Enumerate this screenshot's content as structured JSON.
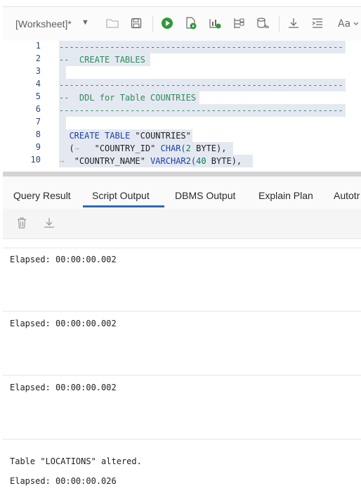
{
  "toolbar": {
    "worksheet_label": "[Worksheet]*",
    "icons": [
      "open-folder-icon",
      "save-icon",
      "run-statement-icon",
      "run-script-icon",
      "autotrace-icon",
      "explain-plan-icon",
      "sql-tuning-icon",
      "download-icon",
      "format-icon",
      "font-icon"
    ]
  },
  "editor": {
    "line_numbers": [
      "1",
      "2",
      "3",
      "4",
      "5",
      "6",
      "7",
      "8",
      "9",
      "10"
    ]
  },
  "tabs": {
    "query_result": "Query Result",
    "script_output": "Script Output",
    "dbms_output": "DBMS Output",
    "explain_plan": "Explain Plan",
    "autotrace": "Autotr"
  },
  "output": {
    "elapsed_1": "Elapsed: 00:00:00.002",
    "elapsed_2": "Elapsed: 00:00:00.002",
    "elapsed_3": "Elapsed: 00:00:00.002",
    "table_altered": "Table \"LOCATIONS\" altered.",
    "elapsed_4": "Elapsed: 00:00:00.026"
  },
  "code": {
    "dashes": "--------------------------------------------------------",
    "dashes_short": "--",
    "line2_text": "CREATE TABLES",
    "line5_text": "DDL for Table COUNTRIES",
    "line8_create": "CREATE",
    "line8_table": "TABLE",
    "line8_name": "\"COUNTRIES\"",
    "line9_open": "(",
    "line9_col": "\"COUNTRY_ID\"",
    "line9_type": "CHAR(",
    "line9_num": "2",
    "line9_byte": "BYTE),",
    "line10_col": "\"COUNTRY_NAME\"",
    "line10_type": "VARCHAR2(",
    "line10_num": "40",
    "line10_byte": "BYTE),"
  },
  "colors": {
    "accent": "#2b6cb5",
    "run_green": "#2e9b3a",
    "selection": "#e4e9f1"
  }
}
